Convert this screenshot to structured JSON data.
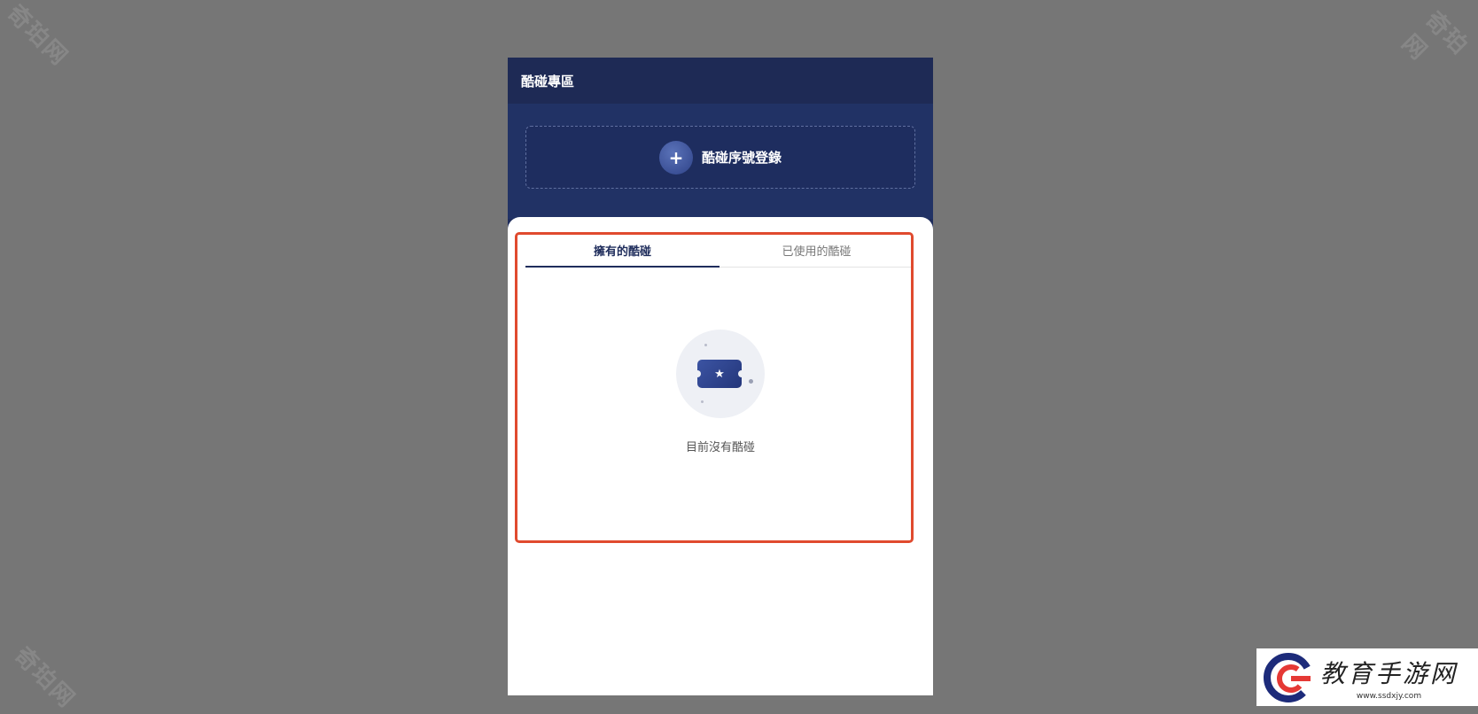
{
  "watermark": {
    "text": "奇珀网"
  },
  "header": {
    "title": "酷碰專區"
  },
  "redeem": {
    "icon": "plus-icon",
    "label": "酷碰序號登錄"
  },
  "tabs": [
    {
      "label": "擁有的酷碰",
      "active": true
    },
    {
      "label": "已使用的酷碰",
      "active": false
    }
  ],
  "empty_state": {
    "icon": "ticket-star-icon",
    "message": "目前沒有酷碰"
  },
  "brand": {
    "name": "教育手游网",
    "url": "www.ssdxjy.com"
  },
  "colors": {
    "header": "#1e2a55",
    "accent": "#1f2d5c",
    "highlight": "#e04a2e",
    "backdrop": "#767676"
  }
}
